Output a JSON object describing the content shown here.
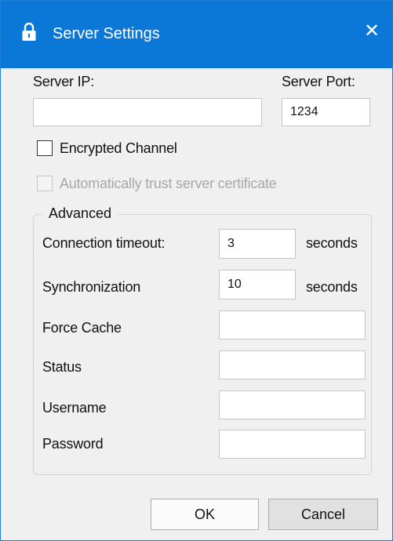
{
  "window": {
    "title": "Server Settings",
    "title_icon": "lock-icon",
    "close_glyph": "✕",
    "accent_color": "#0b78d7"
  },
  "server": {
    "ip_label": "Server IP:",
    "ip_value": "",
    "port_label": "Server Port:",
    "port_value": "1234"
  },
  "options": {
    "encrypted_label": "Encrypted Channel",
    "encrypted_checked": false,
    "trust_cert_label": "Automatically trust server certificate",
    "trust_cert_checked": false,
    "trust_cert_enabled": false
  },
  "advanced": {
    "title": "Advanced",
    "connection_timeout_label": "Connection timeout:",
    "connection_timeout_value": "3",
    "connection_timeout_unit": "seconds",
    "synchronization_label": "Synchronization",
    "synchronization_value": "10",
    "synchronization_unit": "seconds",
    "force_cache_label": "Force Cache",
    "force_cache_value": "",
    "status_label": "Status",
    "status_value": "",
    "username_label": "Username",
    "username_value": "",
    "password_label": "Password",
    "password_value": ""
  },
  "buttons": {
    "ok_label": "OK",
    "cancel_label": "Cancel"
  }
}
